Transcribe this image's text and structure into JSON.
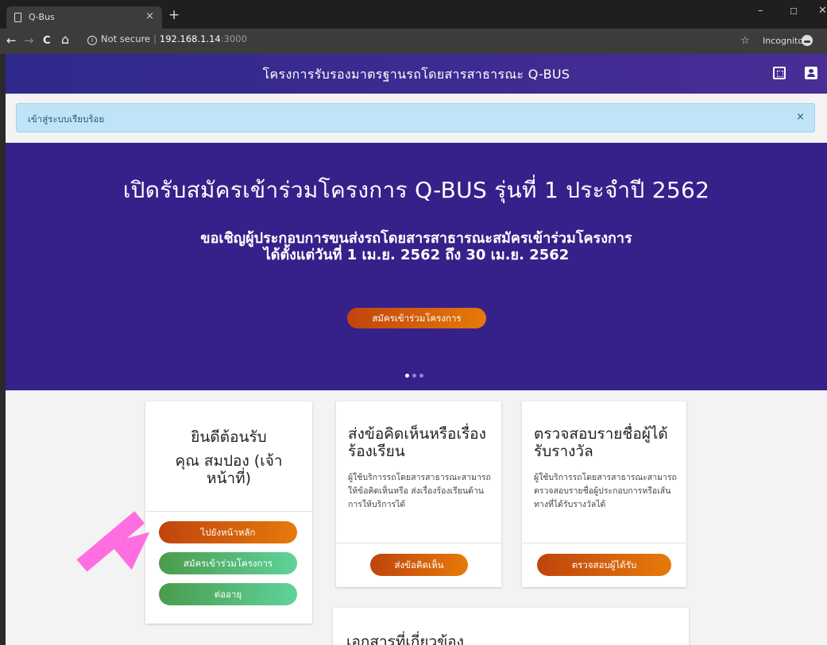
{
  "browser": {
    "tab_title": "Q-Bus",
    "tab_close": "×",
    "new_tab": "+",
    "win_min": "–",
    "win_max": "☐",
    "win_close": "✕",
    "back": "←",
    "forward": "→",
    "reload": "C",
    "home": "⌂",
    "info": "i",
    "security": "Not secure",
    "separator": "|",
    "host": "192.168.1.14",
    "port": ":3000",
    "bookmark": "☆",
    "incognito": "Incognito"
  },
  "app": {
    "title": "โครงการรับรองมาตรฐานรถโดยสารสาธารณะ Q-BUS"
  },
  "alert": {
    "message": "เข้าสู่ระบบเรียบร้อย",
    "close": "×"
  },
  "hero": {
    "title": "เปิดรับสมัครเข้าร่วมโครงการ Q-BUS รุ่นที่ 1 ประจำปี 2562",
    "subtitle_line1": "ขอเชิญผู้ประกอบการขนส่งรถโดยสารสาธารณะสมัครเข้าร่วมโครงการ",
    "subtitle_line2": "ได้ตั้งแต่วันที่ 1 เม.ย. 2562 ถึง 30 เม.ย. 2562",
    "button": "สมัครเข้าร่วมโครงการ",
    "slide_count": 3,
    "active_slide": 1
  },
  "welcome_card": {
    "greeting": "ยินดีต้อนรับ",
    "user": "คุณ สมปอง (เจ้าหน้าที่)",
    "buttons": [
      "ไปยังหน้าหลัก",
      "สมัครเข้าร่วมโครงการ",
      "ต่ออายุ"
    ]
  },
  "feedback_card": {
    "title": "ส่งข้อคิดเห็นหรือเรื่องร้องเรียน",
    "text": "ผู้ใช้บริการรถโดยสารสาธารณะสามารถให้ข้อคิดเห็นหรือ ส่งเรื่องร้องเรียนด้านการให้บริการได้",
    "button": "ส่งข้อคิดเห็น"
  },
  "award_card": {
    "title": "ตรวจสอบรายชื่อผู้ได้รับรางวัล",
    "text": "ผู้ใช้บริการรถโดยสารสาธารณะสามารถตรวจสอบรายชื่อผู้ประกอบการหรือเส้นทางที่ได้รับรางวัลได้",
    "button": "ตรวจสอบผู้ได้รับ"
  },
  "docs_card": {
    "title": "เอกสารที่เกี่ยวข้อง"
  },
  "colors": {
    "header": "#3f2b92",
    "hero": "#36218b",
    "orange": "#e67a0a",
    "green": "#5fd39b",
    "alert": "#bfe4f8",
    "arrow": "#ff6ee0"
  }
}
